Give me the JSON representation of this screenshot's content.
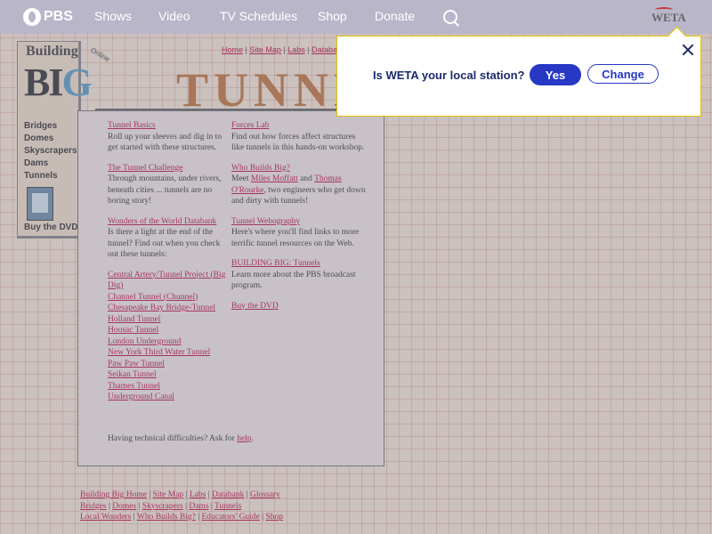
{
  "pbs": {
    "logo": "PBS",
    "nav": [
      "Shows",
      "Video",
      "TV Schedules",
      "Shop",
      "Donate"
    ],
    "station_logo": "WETA"
  },
  "sidebar": {
    "logo_top": "Building",
    "logo_big": "BI",
    "logo_g": "G",
    "logo_online": "Online",
    "items": [
      "Bridges",
      "Domes",
      "Skyscrapers",
      "Dams",
      "Tunnels"
    ],
    "dvd": "Buy the DVD"
  },
  "header": {
    "top_links": [
      "Home",
      "Site Map",
      "Labs",
      "Databa"
    ],
    "title": "TUNNELS"
  },
  "left_col": {
    "basics_title": "Tunnel Basics",
    "basics_text": "Roll up your sleeves and dig in to get started with these structures.",
    "challenge_title": "The Tunnel Challenge",
    "challenge_text": "Through mountains, under rivers, beneath cities ... tunnels are no boring story!",
    "wonders_title": "Wonders of the World Databank",
    "wonders_text": "Is there a light at the end of the tunnel? Find out when you check out these tunnels:",
    "tunnels": [
      "Central Artery/Tunnel Project (Big Dig)",
      "Channel Tunnel (Chunnel)",
      "Chesapeake Bay Bridge-Tunnel",
      "Holland Tunnel",
      "Hoosac Tunnel",
      "London Underground",
      "New York Third Water Tunnel",
      "Paw Paw Tunnel",
      "Seikan Tunnel",
      "Thames Tunnel",
      "Underground Canal"
    ]
  },
  "right_col": {
    "forces_title": "Forces Lab",
    "forces_text": "Find out how forces affect structures like tunnels in this hands-on workshop.",
    "who_title": "Who Builds Big?",
    "who_meet": "Meet",
    "who_name1": "Miles Moffatt",
    "who_and": "and",
    "who_name2": "Thomas O'Rourke",
    "who_text": ", two engineers who get down and dirty with tunnels!",
    "web_title": "Tunnel Webography",
    "web_text": "Here's where you'll find links to more terrific tunnel resources on the Web.",
    "bb_title": "BUILDING BIG: Tunnels",
    "bb_text": "Learn more about the PBS broadcast program.",
    "dvd": "Buy the DVD"
  },
  "tech": {
    "text": "Having technical difficulties? Ask for",
    "link": "help",
    "end": "."
  },
  "footer": {
    "row1": [
      "Building Big Home",
      "Site Map",
      "Labs",
      "Databank",
      "Glossary"
    ],
    "row2": [
      "Bridges",
      "Domes",
      "Skyscrapers",
      "Dams",
      "Tunnels"
    ],
    "row3": [
      "Local Wonders",
      "Who Builds Big?",
      "Educators' Guide",
      "Shop"
    ]
  },
  "dialog": {
    "question": "Is WETA your local station?",
    "yes": "Yes",
    "change": "Change"
  }
}
